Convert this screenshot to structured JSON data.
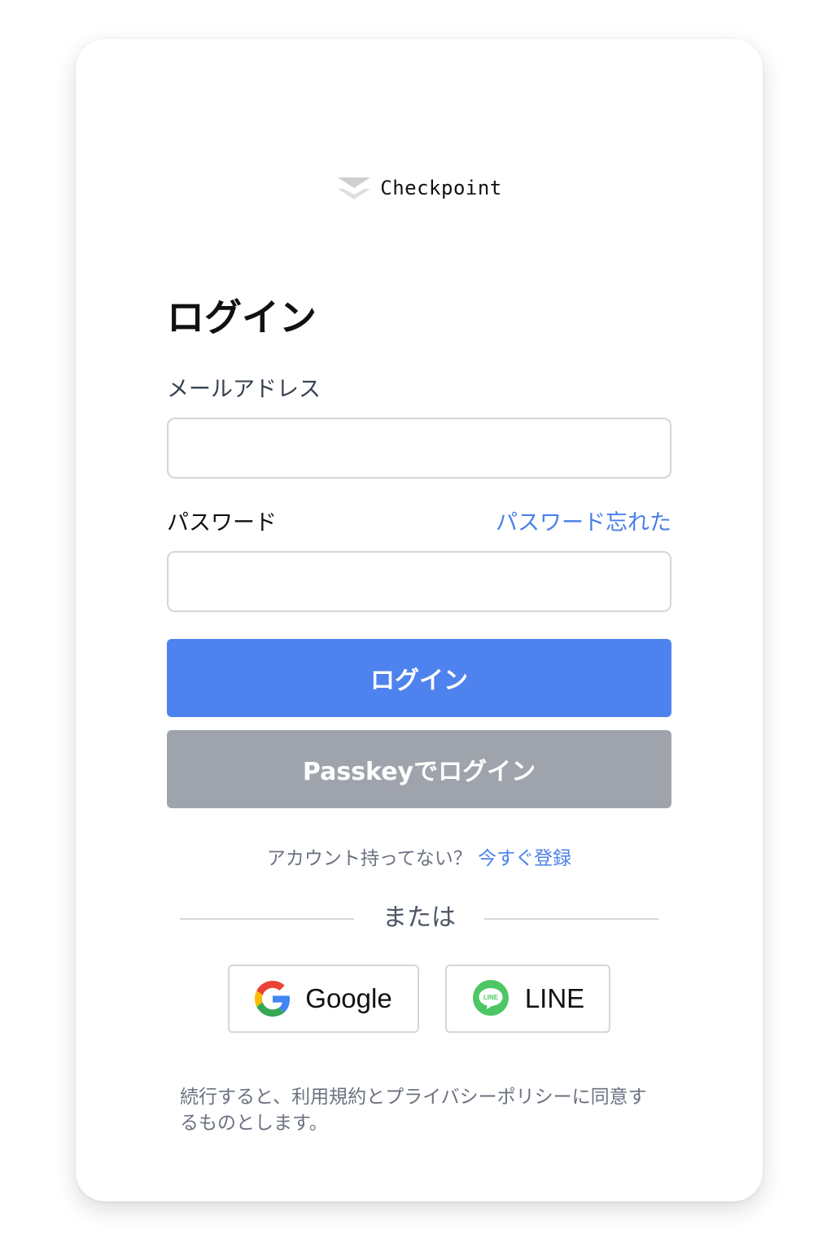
{
  "brand": {
    "name": "Checkpoint",
    "logo_icon": "checkpoint-chevron-logo",
    "logo_colors": [
      "#c9c9c9",
      "#e2e2e2"
    ]
  },
  "form": {
    "title": "ログイン",
    "email": {
      "label": "メールアドレス",
      "value": "",
      "placeholder": ""
    },
    "password": {
      "label": "パスワード",
      "value": "",
      "placeholder": "",
      "forgot_link": "パスワード忘れた"
    },
    "login_button": "ログイン",
    "passkey_button": "Passkeyでログイン"
  },
  "signup": {
    "prompt": "アカウント持ってない？",
    "link": "今すぐ登録"
  },
  "divider_text": "または",
  "social": {
    "google": {
      "label": "Google",
      "icon": "google-icon"
    },
    "line": {
      "label": "LINE",
      "icon": "line-icon",
      "icon_text": "LINE"
    }
  },
  "terms": "続行すると、利用規約とプライバシーポリシーに同意するものとします。",
  "colors": {
    "primary": "#4e82ee",
    "secondary_button": "#9fa3ab",
    "link": "#4a80ea",
    "line_green": "#4cc764"
  }
}
